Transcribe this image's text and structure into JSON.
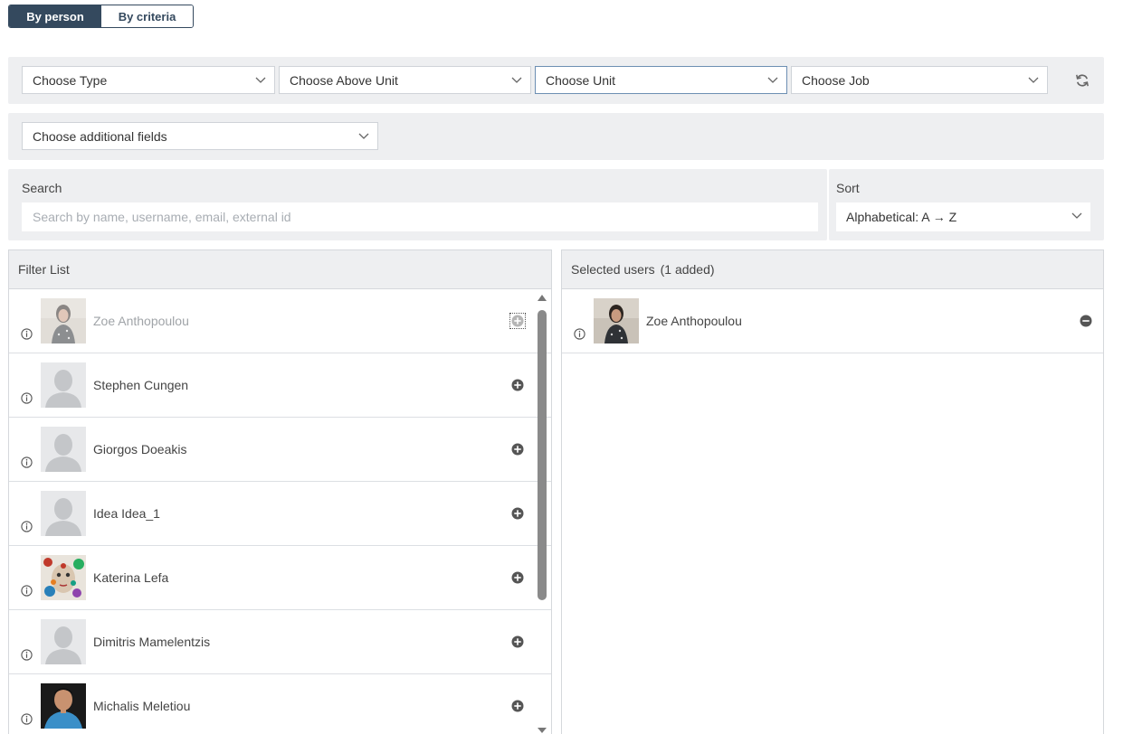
{
  "mode_toggle": {
    "by_person": "By person",
    "by_criteria": "By criteria"
  },
  "filters": {
    "type": "Choose Type",
    "above_unit": "Choose Above Unit",
    "unit": "Choose Unit",
    "job": "Choose Job",
    "additional_fields": "Choose additional fields"
  },
  "search": {
    "label": "Search",
    "placeholder": "Search by name, username, email, external id"
  },
  "sort": {
    "label": "Sort",
    "value": "Alphabetical: A → Z"
  },
  "filter_list": {
    "title": "Filter List",
    "items": [
      {
        "name": "Zoe Anthopoulou",
        "photo": "woman-photo",
        "state": "added"
      },
      {
        "name": "Stephen Cungen",
        "photo": "default-avatar"
      },
      {
        "name": "Giorgos Doeakis",
        "photo": "default-avatar"
      },
      {
        "name": "Idea Idea_1",
        "photo": "default-avatar"
      },
      {
        "name": "Katerina Lefa",
        "photo": "art-photo"
      },
      {
        "name": "Dimitris Mamelentzis",
        "photo": "default-avatar"
      },
      {
        "name": "Michalis Meletiou",
        "photo": "man-photo"
      }
    ]
  },
  "selected": {
    "title": "Selected users",
    "count_text": "(1 added)",
    "items": [
      {
        "name": "Zoe Anthopoulou",
        "photo": "woman-photo"
      }
    ]
  },
  "icons": [
    "chevron-down-icon",
    "refresh-icon",
    "info-icon",
    "add-circle-icon",
    "remove-circle-icon",
    "scroll-up-arrow-icon",
    "scroll-down-arrow-icon"
  ],
  "colors": {
    "toggle_active": "#34495e",
    "panel_bg": "#eeeff1",
    "focused_border": "#6d8fb3"
  }
}
